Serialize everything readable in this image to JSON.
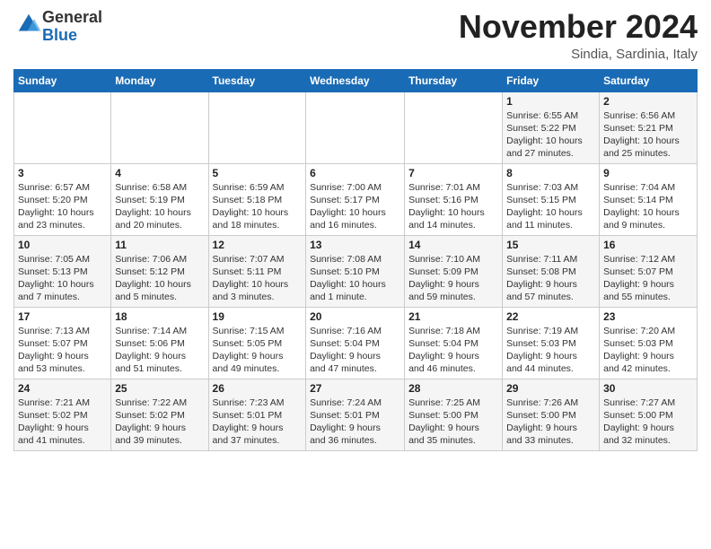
{
  "logo": {
    "general": "General",
    "blue": "Blue"
  },
  "header": {
    "month": "November 2024",
    "location": "Sindia, Sardinia, Italy"
  },
  "weekdays": [
    "Sunday",
    "Monday",
    "Tuesday",
    "Wednesday",
    "Thursday",
    "Friday",
    "Saturday"
  ],
  "weeks": [
    [
      {
        "day": "",
        "info": ""
      },
      {
        "day": "",
        "info": ""
      },
      {
        "day": "",
        "info": ""
      },
      {
        "day": "",
        "info": ""
      },
      {
        "day": "",
        "info": ""
      },
      {
        "day": "1",
        "info": "Sunrise: 6:55 AM\nSunset: 5:22 PM\nDaylight: 10 hours\nand 27 minutes."
      },
      {
        "day": "2",
        "info": "Sunrise: 6:56 AM\nSunset: 5:21 PM\nDaylight: 10 hours\nand 25 minutes."
      }
    ],
    [
      {
        "day": "3",
        "info": "Sunrise: 6:57 AM\nSunset: 5:20 PM\nDaylight: 10 hours\nand 23 minutes."
      },
      {
        "day": "4",
        "info": "Sunrise: 6:58 AM\nSunset: 5:19 PM\nDaylight: 10 hours\nand 20 minutes."
      },
      {
        "day": "5",
        "info": "Sunrise: 6:59 AM\nSunset: 5:18 PM\nDaylight: 10 hours\nand 18 minutes."
      },
      {
        "day": "6",
        "info": "Sunrise: 7:00 AM\nSunset: 5:17 PM\nDaylight: 10 hours\nand 16 minutes."
      },
      {
        "day": "7",
        "info": "Sunrise: 7:01 AM\nSunset: 5:16 PM\nDaylight: 10 hours\nand 14 minutes."
      },
      {
        "day": "8",
        "info": "Sunrise: 7:03 AM\nSunset: 5:15 PM\nDaylight: 10 hours\nand 11 minutes."
      },
      {
        "day": "9",
        "info": "Sunrise: 7:04 AM\nSunset: 5:14 PM\nDaylight: 10 hours\nand 9 minutes."
      }
    ],
    [
      {
        "day": "10",
        "info": "Sunrise: 7:05 AM\nSunset: 5:13 PM\nDaylight: 10 hours\nand 7 minutes."
      },
      {
        "day": "11",
        "info": "Sunrise: 7:06 AM\nSunset: 5:12 PM\nDaylight: 10 hours\nand 5 minutes."
      },
      {
        "day": "12",
        "info": "Sunrise: 7:07 AM\nSunset: 5:11 PM\nDaylight: 10 hours\nand 3 minutes."
      },
      {
        "day": "13",
        "info": "Sunrise: 7:08 AM\nSunset: 5:10 PM\nDaylight: 10 hours\nand 1 minute."
      },
      {
        "day": "14",
        "info": "Sunrise: 7:10 AM\nSunset: 5:09 PM\nDaylight: 9 hours\nand 59 minutes."
      },
      {
        "day": "15",
        "info": "Sunrise: 7:11 AM\nSunset: 5:08 PM\nDaylight: 9 hours\nand 57 minutes."
      },
      {
        "day": "16",
        "info": "Sunrise: 7:12 AM\nSunset: 5:07 PM\nDaylight: 9 hours\nand 55 minutes."
      }
    ],
    [
      {
        "day": "17",
        "info": "Sunrise: 7:13 AM\nSunset: 5:07 PM\nDaylight: 9 hours\nand 53 minutes."
      },
      {
        "day": "18",
        "info": "Sunrise: 7:14 AM\nSunset: 5:06 PM\nDaylight: 9 hours\nand 51 minutes."
      },
      {
        "day": "19",
        "info": "Sunrise: 7:15 AM\nSunset: 5:05 PM\nDaylight: 9 hours\nand 49 minutes."
      },
      {
        "day": "20",
        "info": "Sunrise: 7:16 AM\nSunset: 5:04 PM\nDaylight: 9 hours\nand 47 minutes."
      },
      {
        "day": "21",
        "info": "Sunrise: 7:18 AM\nSunset: 5:04 PM\nDaylight: 9 hours\nand 46 minutes."
      },
      {
        "day": "22",
        "info": "Sunrise: 7:19 AM\nSunset: 5:03 PM\nDaylight: 9 hours\nand 44 minutes."
      },
      {
        "day": "23",
        "info": "Sunrise: 7:20 AM\nSunset: 5:03 PM\nDaylight: 9 hours\nand 42 minutes."
      }
    ],
    [
      {
        "day": "24",
        "info": "Sunrise: 7:21 AM\nSunset: 5:02 PM\nDaylight: 9 hours\nand 41 minutes."
      },
      {
        "day": "25",
        "info": "Sunrise: 7:22 AM\nSunset: 5:02 PM\nDaylight: 9 hours\nand 39 minutes."
      },
      {
        "day": "26",
        "info": "Sunrise: 7:23 AM\nSunset: 5:01 PM\nDaylight: 9 hours\nand 37 minutes."
      },
      {
        "day": "27",
        "info": "Sunrise: 7:24 AM\nSunset: 5:01 PM\nDaylight: 9 hours\nand 36 minutes."
      },
      {
        "day": "28",
        "info": "Sunrise: 7:25 AM\nSunset: 5:00 PM\nDaylight: 9 hours\nand 35 minutes."
      },
      {
        "day": "29",
        "info": "Sunrise: 7:26 AM\nSunset: 5:00 PM\nDaylight: 9 hours\nand 33 minutes."
      },
      {
        "day": "30",
        "info": "Sunrise: 7:27 AM\nSunset: 5:00 PM\nDaylight: 9 hours\nand 32 minutes."
      }
    ]
  ]
}
